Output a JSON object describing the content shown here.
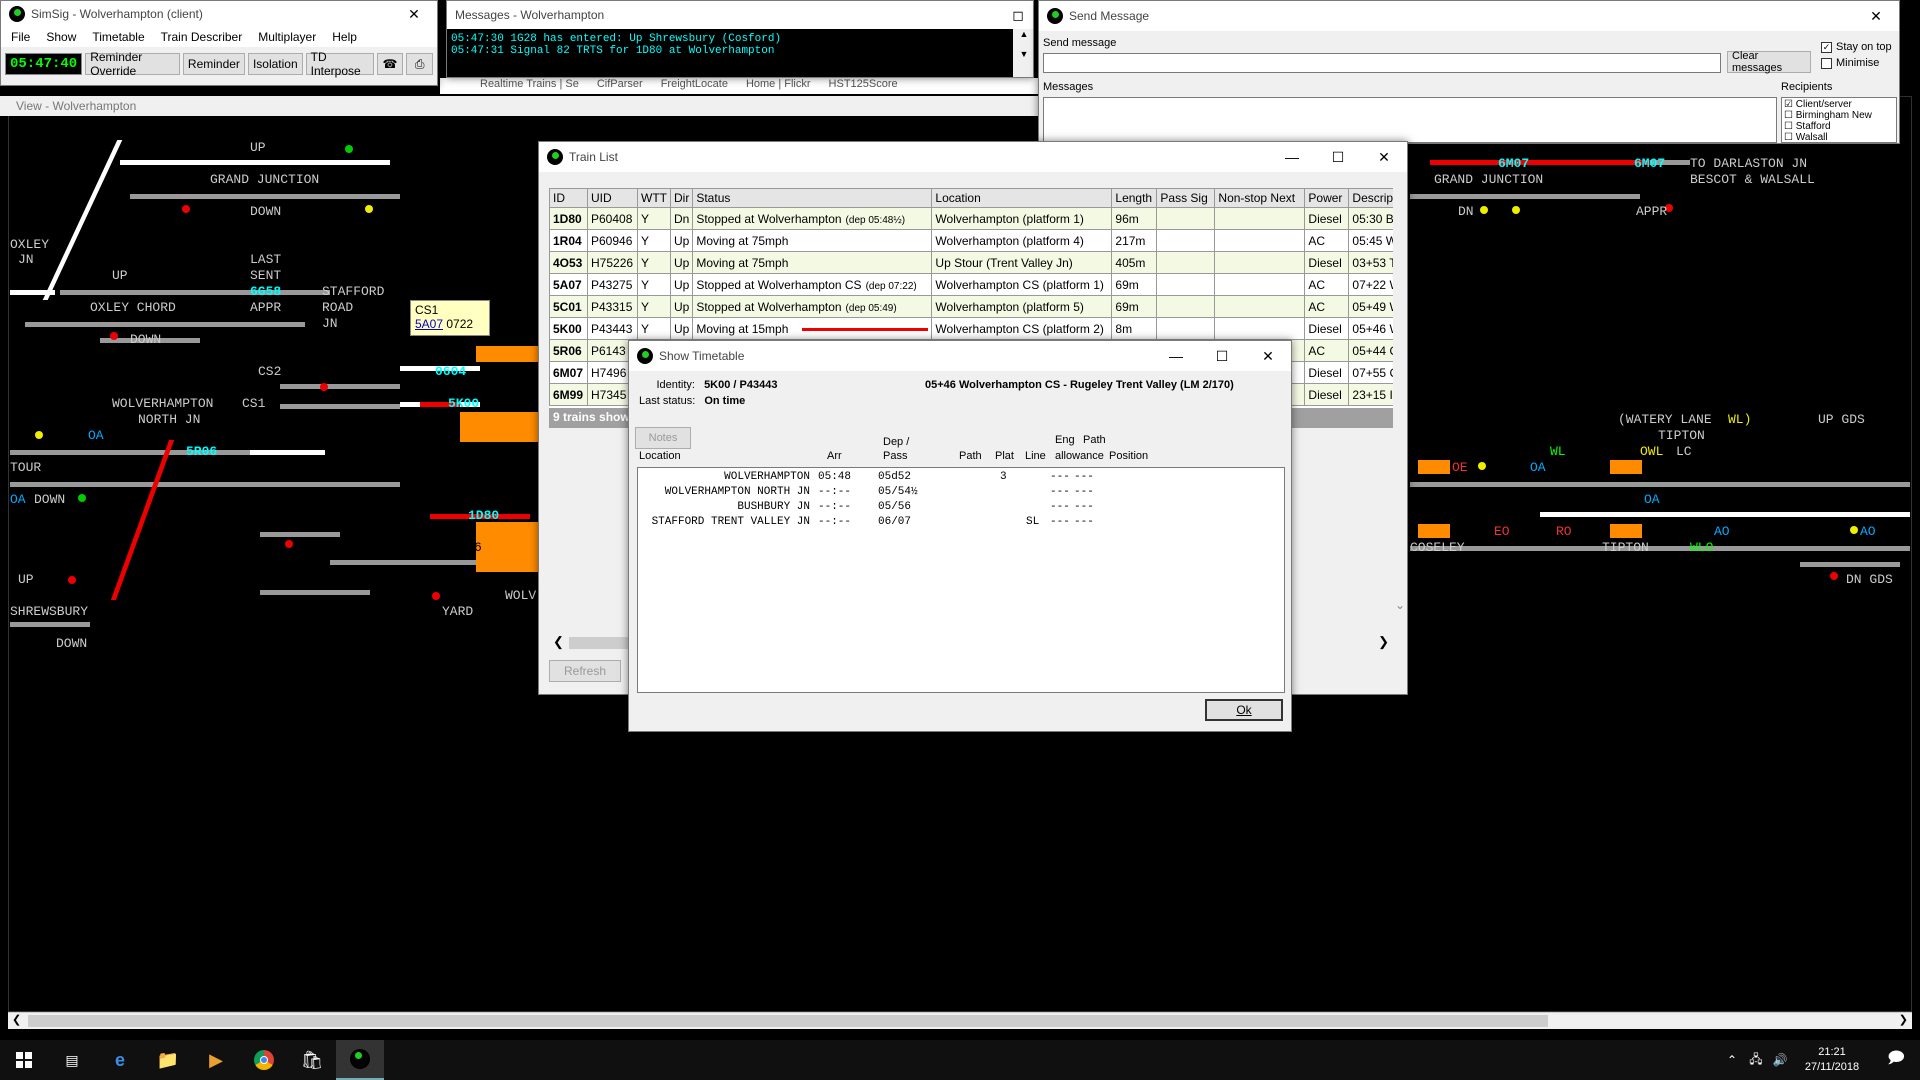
{
  "main_window": {
    "title": "SimSig - Wolverhampton (client)",
    "menu": [
      "File",
      "Show",
      "Timetable",
      "Train Describer",
      "Multiplayer",
      "Help"
    ],
    "clock": "05:47:40",
    "toolbar": [
      "Reminder Override",
      "Reminder",
      "Isolation",
      "TD Interpose"
    ],
    "view_title": "View - Wolverhampton"
  },
  "bookmarks": [
    "Realtime Trains | Se",
    "CifParser",
    "FreightLocate",
    "Home | Flickr",
    "HST125Score"
  ],
  "messages_window": {
    "title": "Messages - Wolverhampton",
    "lines": [
      "05:47:30 1G28 has entered: Up Shrewsbury (Cosford)",
      "05:47:31 Signal 82 TRTS for 1D80 at Wolverhampton"
    ]
  },
  "send_message": {
    "title": "Send Message",
    "send_label": "Send message",
    "clear_label": "Clear messages",
    "stay_on_top": "Stay on top",
    "minimise": "Minimise",
    "messages_label": "Messages",
    "recipients_label": "Recipients",
    "recipients": [
      "Client/server",
      "Birmingham New",
      "Stafford",
      "Walsall"
    ]
  },
  "train_list": {
    "title": "Train List",
    "columns": [
      "ID",
      "UID",
      "WTT",
      "Dir",
      "Status",
      "Location",
      "Length",
      "Pass Sig",
      "Non-stop Next",
      "Power",
      "Descript"
    ],
    "rows": [
      {
        "id": "1D80",
        "uid": "P60408",
        "wtt": "Y",
        "dir": "Dn",
        "status": "Stopped at Wolverhampton",
        "status_note": "(dep 05:48½)",
        "location": "Wolverhampton (platform 1)",
        "length": "96m",
        "power": "Diesel",
        "desc": "05:30 Bir"
      },
      {
        "id": "1R04",
        "uid": "P60946",
        "wtt": "Y",
        "dir": "Up",
        "status": "Moving at 75mph",
        "status_note": "",
        "location": "Wolverhampton (platform 4)",
        "length": "217m",
        "power": "AC",
        "desc": "05:45 Wo"
      },
      {
        "id": "4O53",
        "uid": "H75226",
        "wtt": "Y",
        "dir": "Up",
        "status": "Moving at 75mph",
        "status_note": "",
        "location": "Up Stour (Trent Valley Jn)",
        "length": "405m",
        "power": "Diesel",
        "desc": "03+53 Tr"
      },
      {
        "id": "5A07",
        "uid": "P43275",
        "wtt": "Y",
        "dir": "Up",
        "status": "Stopped at Wolverhampton CS",
        "status_note": "(dep 07:22)",
        "location": "Wolverhampton CS (platform 1)",
        "length": "69m",
        "power": "AC",
        "desc": "07+22 W"
      },
      {
        "id": "5C01",
        "uid": "P43315",
        "wtt": "Y",
        "dir": "Up",
        "status": "Stopped at Wolverhampton",
        "status_note": "(dep 05:49)",
        "location": "Wolverhampton (platform 5)",
        "length": "69m",
        "power": "AC",
        "desc": "05+49 W"
      },
      {
        "id": "5K00",
        "uid": "P43443",
        "wtt": "Y",
        "dir": "Up",
        "status": "Moving at 15mph",
        "status_note": "",
        "location": "Wolverhampton CS (platform 2)",
        "length": "8m",
        "power": "Diesel",
        "desc": "05+46 W"
      },
      {
        "id": "5R06",
        "uid": "P6143",
        "wtt": "",
        "dir": "",
        "status": "",
        "status_note": "",
        "location": "",
        "length": "",
        "power": "AC",
        "desc": "05+44 Ox"
      },
      {
        "id": "6M07",
        "uid": "H7496",
        "wtt": "",
        "dir": "",
        "status": "",
        "status_note": "",
        "location": "",
        "length": "",
        "power": "Diesel",
        "desc": "07+55 Cl"
      },
      {
        "id": "6M99",
        "uid": "H7345",
        "wtt": "",
        "dir": "",
        "status": "",
        "status_note": "",
        "location": "",
        "length": "",
        "power": "Diesel",
        "desc": "23+15 In"
      }
    ],
    "footer": "9 trains show",
    "refresh": "Refresh"
  },
  "timetable": {
    "title": "Show Timetable",
    "identity_label": "Identity:",
    "identity": "5K00 / P43443",
    "status_label": "Last status:",
    "status": "On time",
    "route": "05+46 Wolverhampton CS - Rugeley Trent Valley (LM 2/170)",
    "notes": "Notes",
    "col_location": "Location",
    "col_arr": "Arr",
    "col_dep": "Dep /",
    "col_pass": "Pass",
    "col_path": "Path",
    "col_plat": "Plat",
    "col_line": "Line",
    "col_eng": "Eng",
    "col_allow": "allowance",
    "col_path2": "Path",
    "col_position": "Position",
    "rows": [
      {
        "loc": "WOLVERHAMPTON",
        "arr": "05:48",
        "dep": "05d52",
        "plat": "3",
        "line": "",
        "eng": "---",
        "pa": "---"
      },
      {
        "loc": "WOLVERHAMPTON NORTH JN",
        "arr": "--:--",
        "dep": "05/54½",
        "plat": "",
        "line": "",
        "eng": "---",
        "pa": "---"
      },
      {
        "loc": "BUSHBURY JN",
        "arr": "--:--",
        "dep": "05/56",
        "plat": "",
        "line": "",
        "eng": "---",
        "pa": "---"
      },
      {
        "loc": "STAFFORD TRENT VALLEY JN",
        "arr": "--:--",
        "dep": "06/07",
        "plat": "",
        "line": "SL",
        "eng": "---",
        "pa": "---"
      }
    ],
    "ok": "Ok"
  },
  "diagram": {
    "labels": {
      "up_top": "UP",
      "grand_junction": "GRAND JUNCTION",
      "down_top": "DOWN",
      "oxley": "OXLEY",
      "jn": "JN",
      "up_oxley": "UP",
      "last": "LAST",
      "sent": "SENT",
      "last_sent_berth": "6G58",
      "appr": "APPR",
      "stafford": "STAFFORD",
      "road": "ROAD",
      "jn2": "JN",
      "oxley_chord": "OXLEY CHORD",
      "down2": "DOWN",
      "cs2": "CS2",
      "cs1": "CS1",
      "wolv_north": "WOLVERHAMPTON",
      "north_jn": "NORTH JN",
      "tour": "TOUR",
      "down3": "DOWN",
      "up_shrew": "UP",
      "shrewsbury": "SHREWSBURY",
      "down4": "DOWN",
      "yard": "YARD",
      "wolv": "WOLV",
      "to_darlaston": "TO DARLASTON JN",
      "bescot": "BESCOT & WALSALL",
      "grand_junction_r": "GRAND JUNCTION",
      "dn_r": "DN",
      "appr_r": "APPR",
      "watery": "(WATERY LANE",
      "wl": "WL)",
      "tipton": "TIPTON",
      "up_gds": "UP GDS",
      "lc": "LC",
      "coseley": "COSELEY",
      "tipton2": "TIPTON",
      "dn_gds": "DN GDS",
      "plat6": "6"
    },
    "berths": {
      "b0604": "0604",
      "b5k00": "5K00",
      "b5r06": "5R06",
      "b1d80": "1D80",
      "b6m07a": "6M07",
      "b6m07b": "6M07"
    },
    "tooltip": {
      "line1": "CS1",
      "link": "5A07",
      "time": "0722"
    },
    "code_labels": [
      "OA",
      "OE",
      "OA",
      "WL",
      "OWL",
      "OA",
      "EO",
      "RO",
      "WLO",
      "AO",
      "AO",
      "OA"
    ]
  },
  "taskbar": {
    "time": "21:21",
    "date": "27/11/2018"
  }
}
